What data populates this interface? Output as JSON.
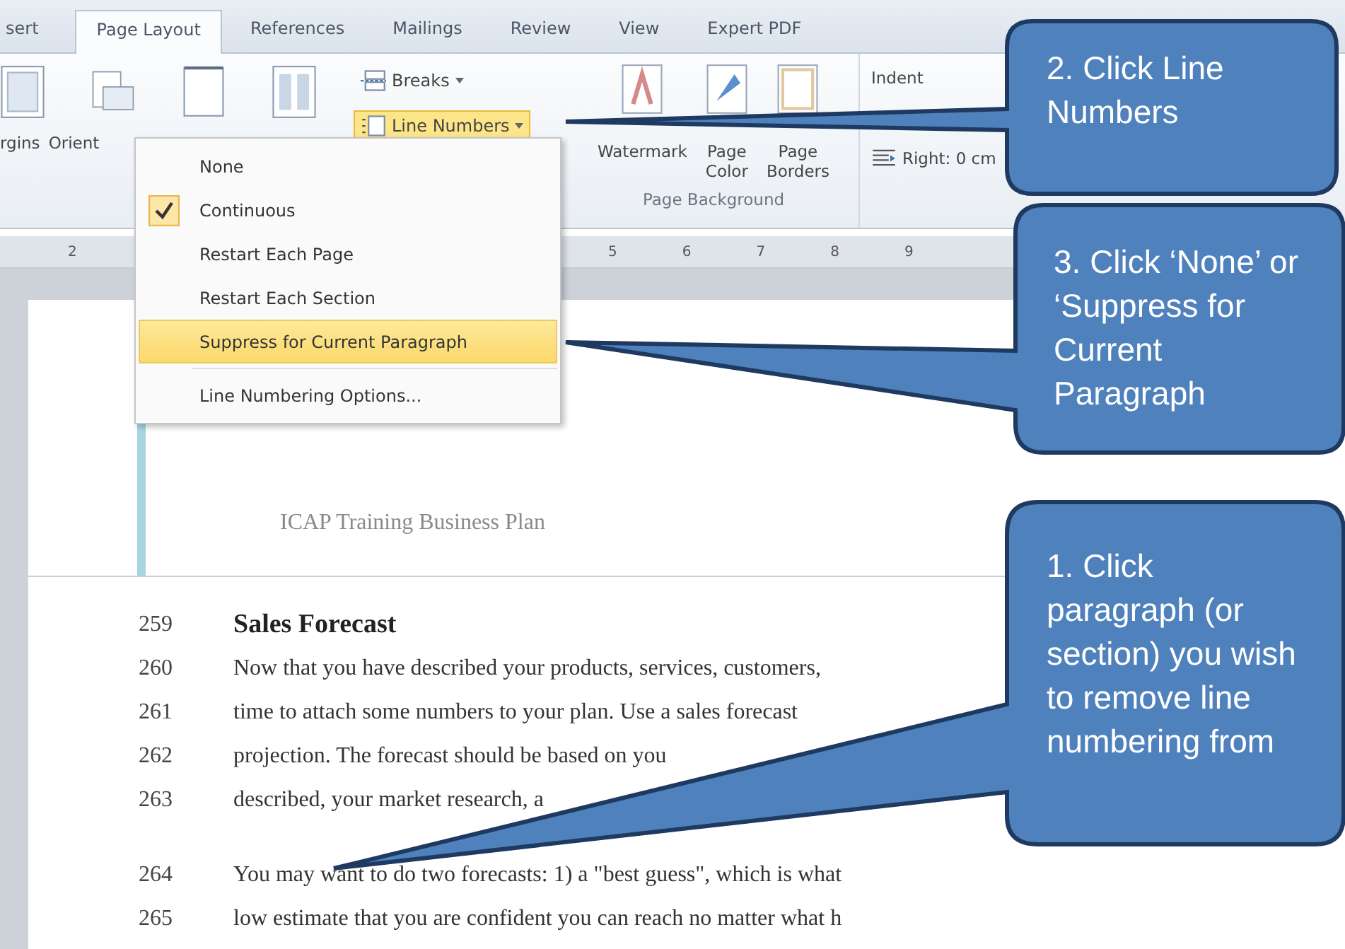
{
  "ribbon_tabs": [
    {
      "label": "sert",
      "selected": false
    },
    {
      "label": "Page Layout",
      "selected": true
    },
    {
      "label": "References",
      "selected": false
    },
    {
      "label": "Mailings",
      "selected": false
    },
    {
      "label": "Review",
      "selected": false
    },
    {
      "label": "View",
      "selected": false
    },
    {
      "label": "Expert PDF",
      "selected": false
    }
  ],
  "ribbon": {
    "page_setup_labels": [
      "rgins",
      "Orient"
    ],
    "breaks": "Breaks",
    "line_numbers": {
      "label": "Line Numbers",
      "selected": true
    },
    "background_buttons": [
      {
        "lines": [
          "Watermark"
        ]
      },
      {
        "lines": [
          "Page",
          "Color"
        ]
      },
      {
        "lines": [
          "Page",
          "Borders"
        ]
      }
    ],
    "group_label": "Page Background",
    "indent_label": "Indent",
    "right_indent": "Right: 0 cm"
  },
  "line_numbers_menu": [
    {
      "label": "None",
      "checked": false,
      "highlighted": false
    },
    {
      "label": "Continuous",
      "checked": true,
      "highlighted": false
    },
    {
      "label": "Restart Each Page",
      "checked": false,
      "highlighted": false
    },
    {
      "label": "Restart Each Section",
      "checked": false,
      "highlighted": false
    },
    {
      "label": "Suppress for Current Paragraph",
      "checked": false,
      "highlighted": true
    },
    {
      "label": "Line Numbering Options...",
      "checked": false,
      "highlighted": false
    }
  ],
  "ruler": {
    "left_numbers": [
      "2"
    ],
    "right_numbers": [
      "5",
      "6",
      "7",
      "8",
      "9"
    ]
  },
  "document": {
    "header": "ICAP Training Business Plan",
    "lines": [
      {
        "number": "259",
        "text": "Sales Forecast",
        "kind": "heading"
      },
      {
        "number": "260",
        "text": "Now that you have described your products, services, customers,",
        "kind": "body"
      },
      {
        "number": "261",
        "text": "time to attach some numbers to your plan. Use a sales forecast",
        "kind": "body"
      },
      {
        "number": "262",
        "text": "projection. The forecast should be based on you",
        "kind": "body"
      },
      {
        "number": "263",
        "text": "described, your market research, a",
        "kind": "body"
      },
      {
        "number": "264",
        "text": "You may want to do two forecasts: 1) a \"best guess\", which is what",
        "kind": "gap"
      },
      {
        "number": "265",
        "text": "low estimate that you are confident you can reach no matter what h",
        "kind": "body"
      }
    ]
  },
  "callouts": [
    {
      "text": "2. Click Line Numbers"
    },
    {
      "text": "3. Click ‘None’ or ‘Suppress for Current Paragraph"
    },
    {
      "text": "1. Click paragraph (or section) you wish to remove line numbering from"
    }
  ]
}
